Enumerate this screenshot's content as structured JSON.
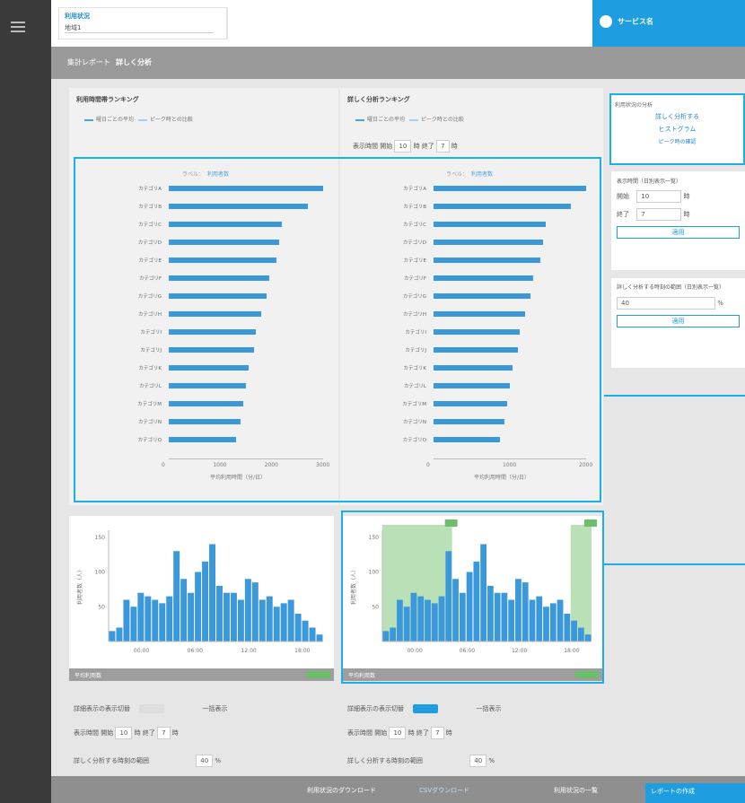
{
  "top": {
    "title": "利用状況",
    "subtitle": "地域1",
    "right_label": "サービス名"
  },
  "crumb": {
    "path": "集計レポート",
    "current": "詳しく分析"
  },
  "left_panel": {
    "title": "利用時間帯ランキング",
    "legend_a": "曜日ごとの平均",
    "legend_b": "ピーク時との比較"
  },
  "right_panel": {
    "title": "詳しく分析ランキング",
    "legend_a": "曜日ごとの平均",
    "legend_b": "ピーク時との比較",
    "range_label": "表示時間",
    "start_label": "開始",
    "start_value": "10",
    "end_label": "終了",
    "end_value": "7",
    "unit": "時"
  },
  "bar_chart_common": {
    "cap_prefix": "ラベル：",
    "cap_value": "利用者数",
    "xlabel": "平均利用時間（分/日）",
    "x_ticks": [
      "0",
      "1000",
      "2000",
      "3000"
    ]
  },
  "bar_chart_right": {
    "x_ticks": [
      "0",
      "1000",
      "2000"
    ]
  },
  "categories": [
    "カテゴリA",
    "カテゴリB",
    "カテゴリC",
    "カテゴリD",
    "カテゴリE",
    "カテゴリF",
    "カテゴリG",
    "カテゴリH",
    "カテゴリI",
    "カテゴリJ",
    "カテゴリK",
    "カテゴリL",
    "カテゴリM",
    "カテゴリN",
    "カテゴリO"
  ],
  "chart_data": [
    {
      "type": "bar",
      "orientation": "horizontal",
      "x_range": [
        0,
        3000
      ],
      "values": [
        3000,
        2700,
        2200,
        2150,
        2100,
        1950,
        1900,
        1800,
        1700,
        1650,
        1550,
        1500,
        1450,
        1400,
        1300
      ]
    },
    {
      "type": "bar",
      "orientation": "horizontal",
      "x_range": [
        0,
        3000
      ],
      "values": [
        3000,
        2700,
        2200,
        2150,
        2100,
        1950,
        1900,
        1800,
        1700,
        1650,
        1550,
        1500,
        1450,
        1400,
        1300
      ]
    },
    {
      "type": "bar",
      "x_ticks": [
        "00:00",
        "06:00",
        "12:00",
        "18:00"
      ],
      "y_range": [
        0,
        160
      ],
      "values": [
        15,
        20,
        60,
        50,
        70,
        65,
        60,
        55,
        65,
        130,
        90,
        70,
        100,
        115,
        140,
        80,
        70,
        70,
        60,
        90,
        85,
        60,
        65,
        50,
        55,
        60,
        40,
        30,
        20,
        10
      ]
    },
    {
      "type": "bar",
      "x_ticks": [
        "00:00",
        "06:00",
        "12:00",
        "18:00"
      ],
      "y_range": [
        0,
        160
      ],
      "values": [
        15,
        20,
        60,
        50,
        70,
        65,
        60,
        55,
        65,
        130,
        90,
        70,
        100,
        115,
        140,
        80,
        70,
        70,
        60,
        90,
        85,
        60,
        65,
        50,
        55,
        60,
        40,
        30,
        20,
        10
      ],
      "highlight_ranges": [
        [
          0,
          10
        ],
        [
          27,
          30
        ]
      ]
    }
  ],
  "hist_common": {
    "ylabel": "利用者数（人）",
    "y_ticks": [
      "150",
      "100",
      "50"
    ],
    "x_ticks": [
      "00:00",
      "06:00",
      "12:00",
      "18:00"
    ],
    "foot_label": "平均利用数"
  },
  "bottom_controls": {
    "left_row1": "詳細表示の表示切替",
    "left_row1b": "一括表示",
    "left_row2_a": "表示時間",
    "left_row2_b": "開始",
    "left_row2_c": "10",
    "left_row2_d": "時",
    "left_row2_e": "終了",
    "left_row2_f": "7",
    "left_row2_g": "時",
    "left_row3": "詳しく分析する時刻の範囲",
    "left_row3_val": "40",
    "left_row3_unit": "%",
    "right_row1": "詳細表示の表示切替",
    "right_row1b": "一括表示",
    "right_row2_a": "表示時間",
    "right_row2_b": "開始",
    "right_row2_c": "10",
    "right_row2_d": "時",
    "right_row2_e": "終了",
    "right_row2_f": "7",
    "right_row2_g": "時",
    "right_row3": "詳しく分析する時刻の範囲",
    "right_row3_val": "40",
    "right_row3_unit": "%"
  },
  "side": {
    "card_header": "利用状況の分析",
    "card_line1": "詳しく分析する",
    "card_line2": "ヒストグラム",
    "card_line3": "ピーク時の確認",
    "form1_title": "表示時間（日別表示一覧）",
    "form1_start": "開始",
    "form1_start_val": "10",
    "form1_end": "終了",
    "form1_end_val": "7",
    "form1_unit": "時",
    "form1_btn": "適用",
    "form2_title": "詳しく分析する時刻の範囲（日別表示一覧）",
    "form2_val": "40",
    "form2_unit": "%",
    "form2_btn": "適用"
  },
  "bottom": {
    "txt1": "利用状況のダウンロード",
    "txt2": "CSVダウンロード",
    "txt3": "利用状況の一覧",
    "btn": "レポートの作成"
  }
}
